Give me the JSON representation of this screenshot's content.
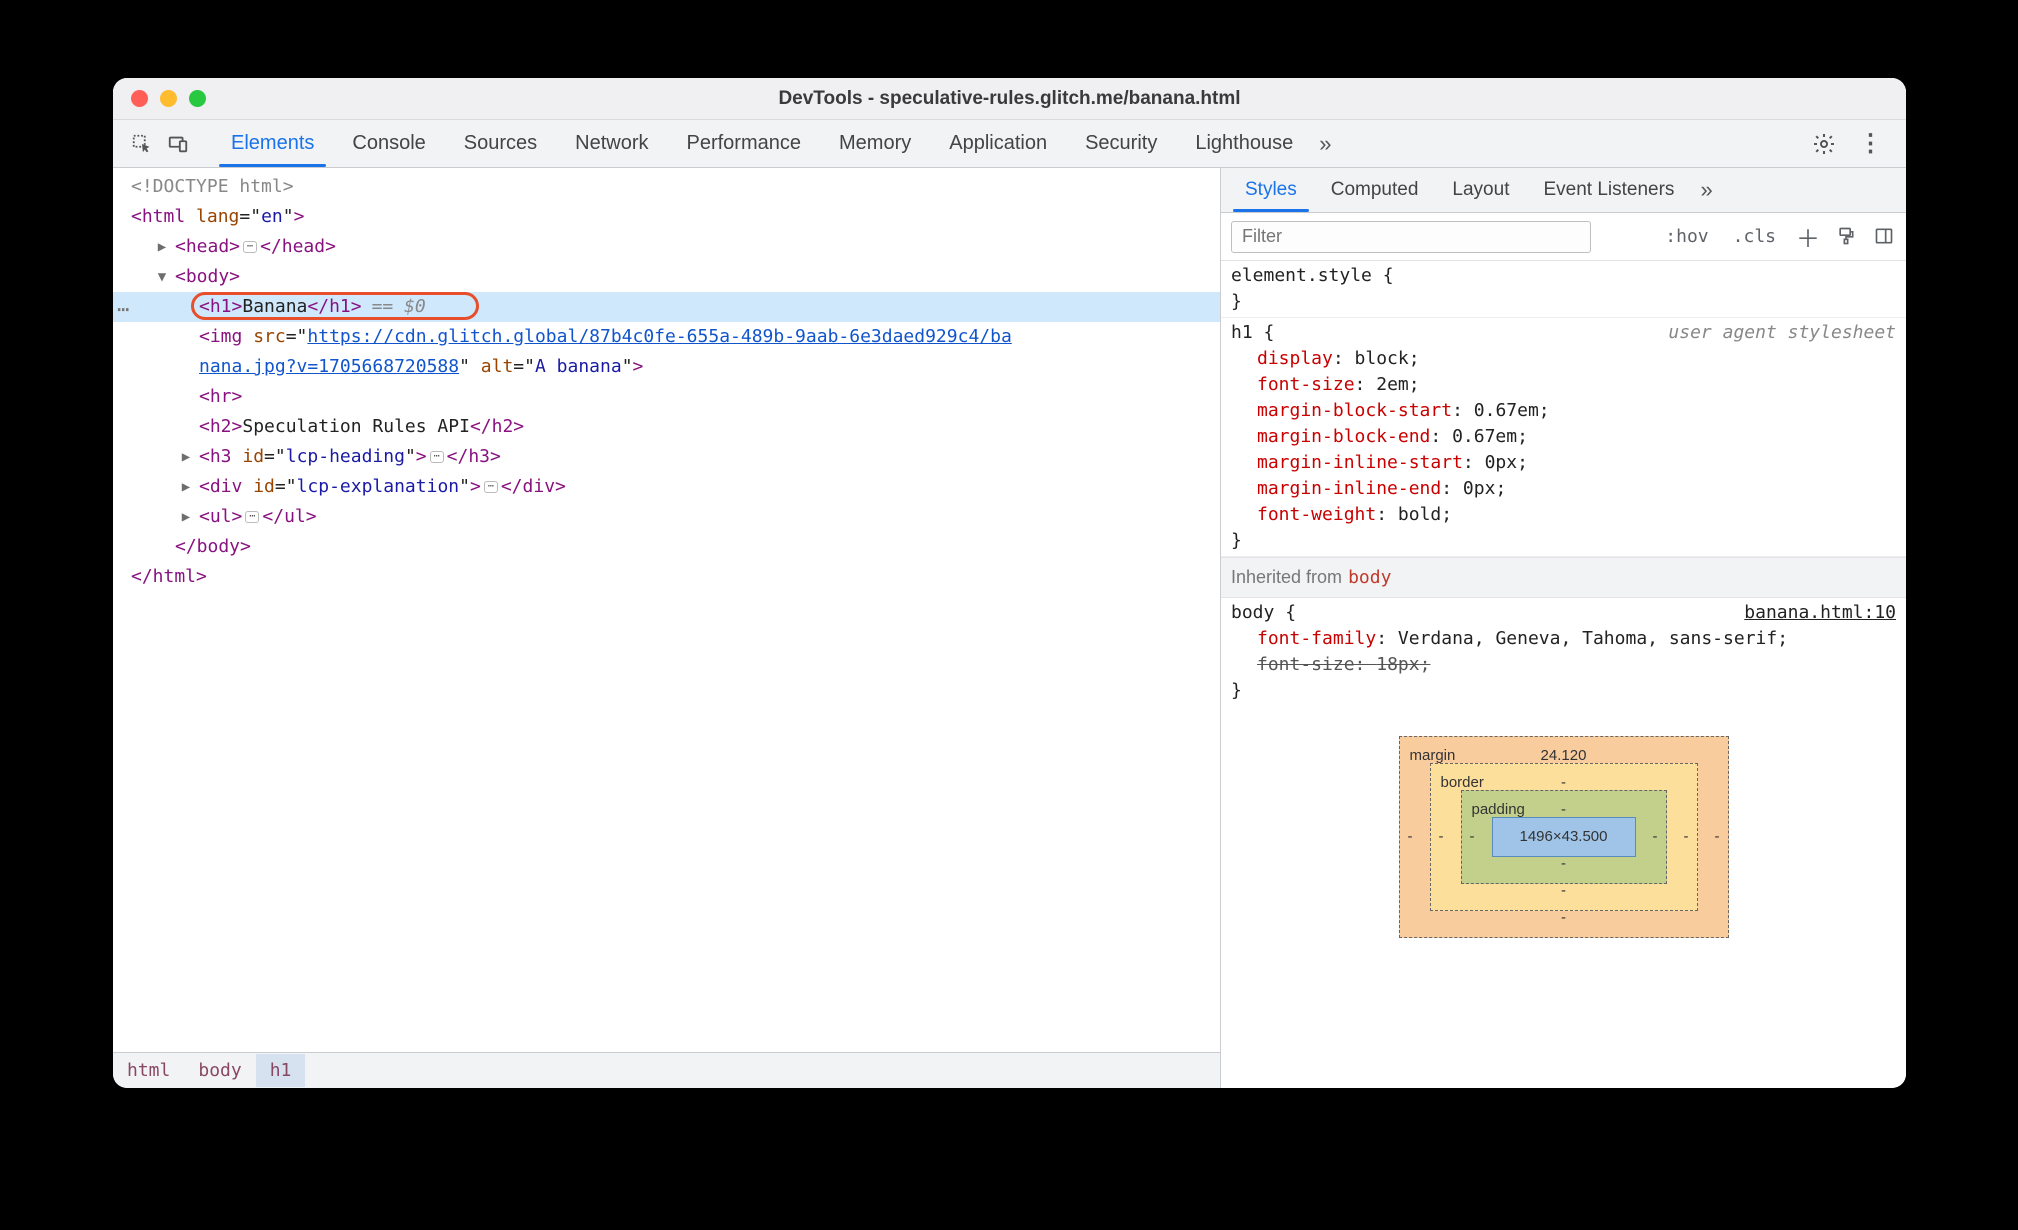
{
  "title": "DevTools - speculative-rules.glitch.me/banana.html",
  "tabs": [
    "Elements",
    "Console",
    "Sources",
    "Network",
    "Performance",
    "Memory",
    "Application",
    "Security",
    "Lighthouse"
  ],
  "tabs_active_index": 0,
  "dom": {
    "doctype": "<!DOCTYPE html>",
    "html_open": "<html lang=\"en\">",
    "head": {
      "open": "<head>",
      "close": "</head>"
    },
    "body_open": "<body>",
    "h1": {
      "open": "<h1>",
      "text": "Banana",
      "close": "</h1>",
      "suffix": "== $0"
    },
    "img": {
      "tag": "img",
      "src_prefix": "<img src=\"",
      "src": "https://cdn.glitch.global/87b4c0fe-655a-489b-9aab-6e3daed929c4/banana.jpg?v=1705668720588",
      "src_visible_line1": "https://cdn.glitch.global/87b4c0fe-655a-489b-9aab-6e3daed929c4/ba",
      "src_visible_line2": "nana.jpg?v=1705668720588",
      "alt": "A banana",
      "close_suffix": "\" alt=\"A banana\">"
    },
    "hr": "<hr>",
    "h2": {
      "open": "<h2>",
      "text": "Speculation Rules API",
      "close": "</h2>"
    },
    "h3": {
      "raw": "<h3 id=\"lcp-heading\">",
      "close": "</h3>"
    },
    "div": {
      "raw": "<div id=\"lcp-explanation\">",
      "close": "</div>"
    },
    "ul": {
      "open": "<ul>",
      "close": "</ul>"
    },
    "body_close": "</body>",
    "html_close": "</html>"
  },
  "breadcrumb": [
    "html",
    "body",
    "h1"
  ],
  "styles_tabs": [
    "Styles",
    "Computed",
    "Layout",
    "Event Listeners"
  ],
  "styles_active_index": 0,
  "filter_placeholder": "Filter",
  "filter_btns": {
    "hov": ":hov",
    "cls": ".cls"
  },
  "rules": {
    "element_style": {
      "selector": "element.style",
      "props": []
    },
    "h1": {
      "selector": "h1",
      "note": "user agent stylesheet",
      "props": [
        {
          "n": "display",
          "v": "block"
        },
        {
          "n": "font-size",
          "v": "2em"
        },
        {
          "n": "margin-block-start",
          "v": "0.67em"
        },
        {
          "n": "margin-block-end",
          "v": "0.67em"
        },
        {
          "n": "margin-inline-start",
          "v": "0px"
        },
        {
          "n": "margin-inline-end",
          "v": "0px"
        },
        {
          "n": "font-weight",
          "v": "bold"
        }
      ]
    },
    "inherited_label": "Inherited from",
    "inherited_from": "body",
    "body_rule": {
      "selector": "body",
      "srclink": "banana.html:10",
      "props": [
        {
          "n": "font-family",
          "v": "Verdana, Geneva, Tahoma, sans-serif",
          "strike": false
        },
        {
          "n": "font-size",
          "v": "18px",
          "strike": true
        }
      ]
    }
  },
  "boxmodel": {
    "margin": {
      "label": "margin",
      "top": "24.120",
      "left": "-",
      "right": "-",
      "bottom": "-"
    },
    "border": {
      "label": "border",
      "top": "-",
      "left": "-",
      "right": "-",
      "bottom": "-"
    },
    "padding": {
      "label": "padding",
      "top": "-",
      "left": "-",
      "right": "-",
      "bottom": "-"
    },
    "content": "1496×43.500"
  }
}
